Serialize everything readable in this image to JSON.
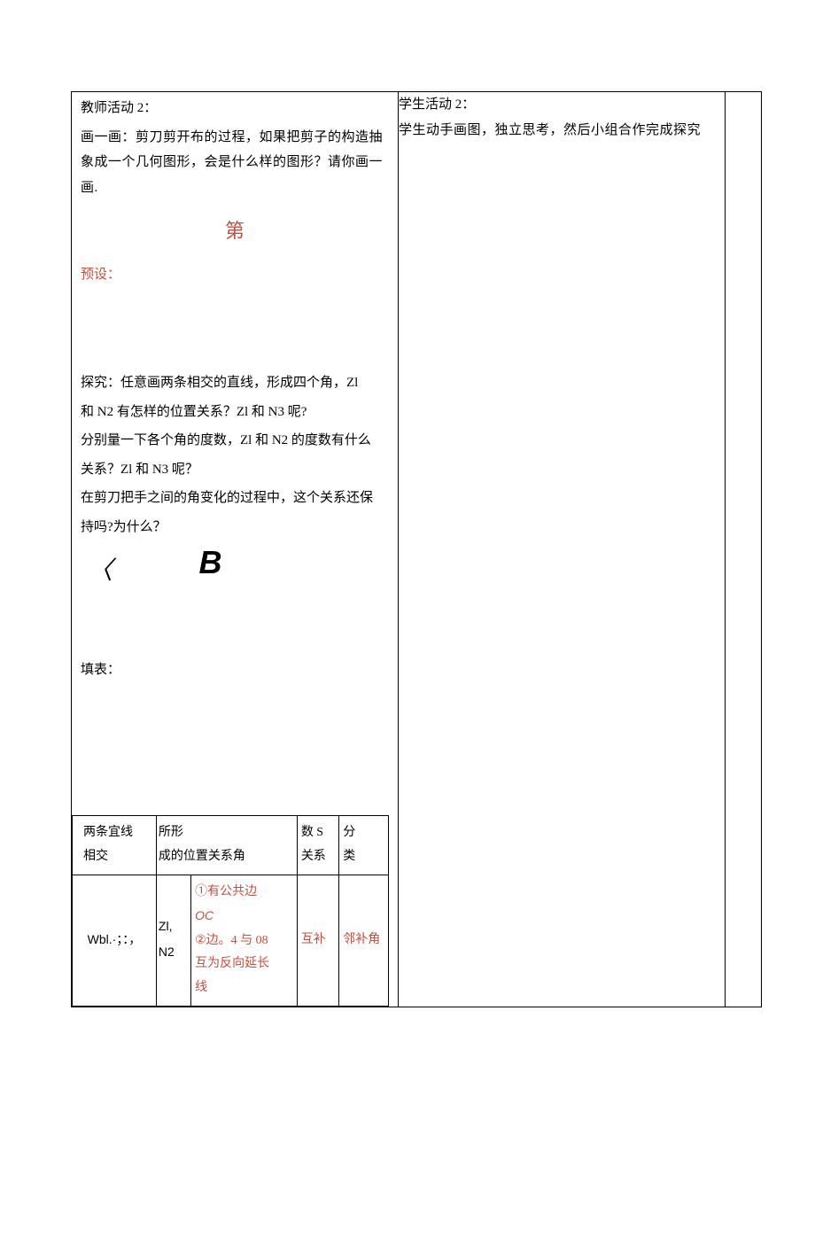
{
  "teacher": {
    "title": "教师活动 2：",
    "p1": "画一画：剪刀剪开布的过程，如果把剪子的构造抽象成一个几何图形，会是什么样的图形？请你画一画.",
    "center_char": "第",
    "preset_label": "预设：",
    "explore_l1": "探究：任意画两条相交的直线，形成四个角，Zl",
    "explore_l2": "和 N2 有怎样的位置关系？Zl 和 N3 呢?",
    "explore_l3": "分别量一下各个角的度数，Zl 和 N2 的度数有什么",
    "explore_l4": "关系？Zl 和 N3 呢？",
    "explore_l5": "在剪刀把手之间的角变化的过程中，这个关系还保",
    "explore_l6": "持吗?为什么？",
    "arc_glyph": "〈",
    "big_b": "B",
    "fill_label": "填表："
  },
  "inner": {
    "h1_l1": "两条宜线",
    "h1_l2": "相交",
    "h2_l1": "所形",
    "h2_l2": "成的位置关系角",
    "h3_l1": "数 S",
    "h3_l2": "关系",
    "h4_l1": "分",
    "h4_l2": "类",
    "r1c1": "Wbl.·；：，",
    "r1c2a_l1": "Zl,",
    "r1c2a_l2": "N2",
    "r1c2b_l1": "①有公共边",
    "r1c2b_l2": "OC",
    "r1c2b_l3": "②边。4 与 08",
    "r1c2b_l4": "互为反向延长",
    "r1c2b_l5": "线",
    "r1c3": "互补",
    "r1c4": "邻补角"
  },
  "student": {
    "title": "学生活动 2：",
    "p1": "学生动手画图，独立思考，然后小组合作完成探究"
  }
}
